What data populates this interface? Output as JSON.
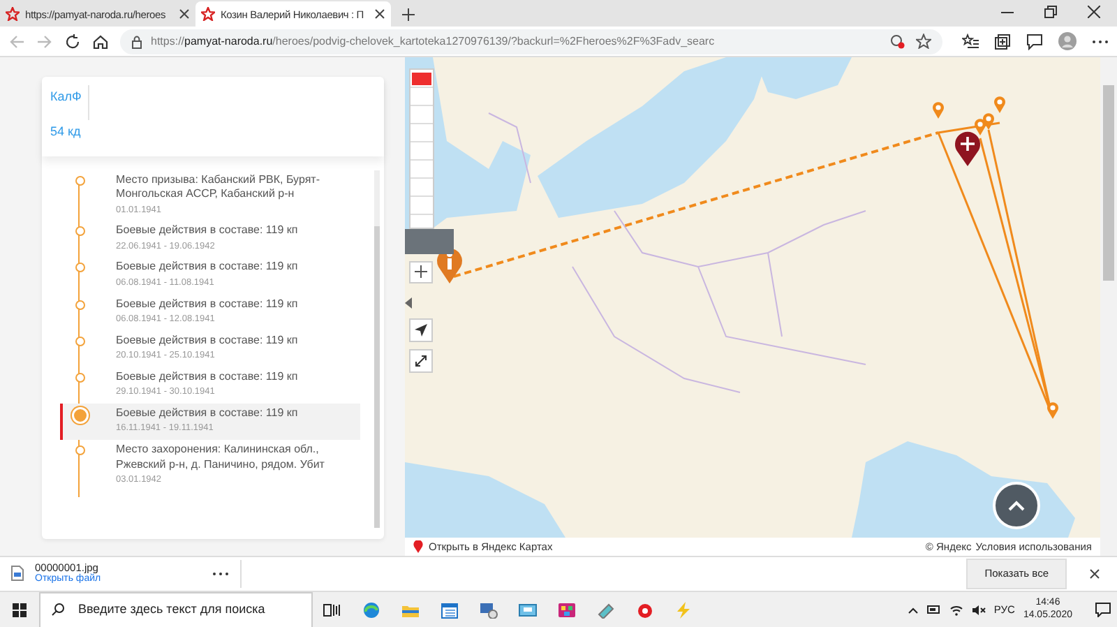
{
  "browser": {
    "tabs": [
      {
        "title": "https://pamyat-naroda.ru/heroes",
        "selected": false
      },
      {
        "title": "Козин Валерий Николаевич : П",
        "selected": true
      }
    ],
    "url_scheme": "https://",
    "url_host": "pamyat-naroda.ru",
    "url_path": "/heroes/podvig-chelovek_kartoteka1270976139/?backurl=%2Fheroes%2F%3Fadv_searc"
  },
  "card": {
    "links": [
      "КалФ",
      "54 кд"
    ],
    "events": [
      {
        "title": "Место призыва: Кабанский РВК, Бурят-Монгольская АССР, Кабанский р-н",
        "date": "01.01.1941",
        "selected": false
      },
      {
        "title": "Боевые действия в составе: 119 кп",
        "date": "22.06.1941 - 19.06.1942",
        "selected": false
      },
      {
        "title": "Боевые действия в составе: 119 кп",
        "date": "06.08.1941 - 11.08.1941",
        "selected": false
      },
      {
        "title": "Боевые действия в составе: 119 кп",
        "date": "06.08.1941 - 12.08.1941",
        "selected": false
      },
      {
        "title": "Боевые действия в составе: 119 кп",
        "date": "20.10.1941 - 25.10.1941",
        "selected": false
      },
      {
        "title": "Боевые действия в составе: 119 кп",
        "date": "29.10.1941 - 30.10.1941",
        "selected": false
      },
      {
        "title": "Боевые действия в составе: 119 кп",
        "date": "16.11.1941 - 19.11.1941",
        "selected": true
      },
      {
        "title": "Место захоронения: Калининская обл., Ржевский р-н, д. Паничино, рядом. Убит",
        "date": "03.01.1942",
        "selected": false
      }
    ]
  },
  "map": {
    "open_link": "Открыть в Яндекс Картах",
    "copyright": "© Яндекс",
    "terms": "Условия использования"
  },
  "download": {
    "filename": "00000001.jpg",
    "action": "Открыть файл",
    "show_all": "Показать все"
  },
  "taskbar": {
    "search_placeholder": "Введите здесь текст для поиска",
    "language": "РУС",
    "time": "14:46",
    "date": "14.05.2020"
  }
}
